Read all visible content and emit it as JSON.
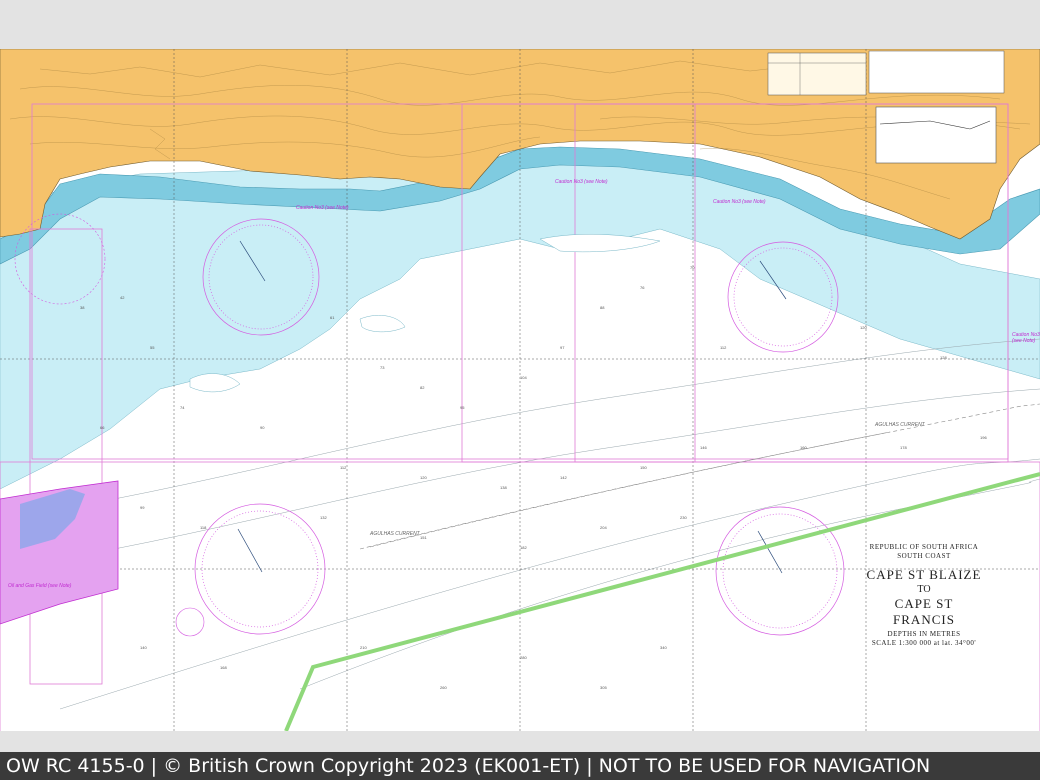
{
  "chart": {
    "republic": "REPUBLIC OF SOUTH AFRICA",
    "coast": "SOUTH COAST",
    "title_line1": "CAPE ST BLAIZE",
    "title_to": "TO",
    "title_line2": "CAPE ST FRANCIS",
    "depths": "DEPTHS IN METRES",
    "scale": "SCALE 1:300 000 at lat. 34°00'",
    "oil_gas_label": "Oil and Gas Field (see Note)",
    "caution_note": "Caution No3 (see Note)",
    "current_label": "AGULHAS CURRENT"
  },
  "footer": {
    "caption": "OW RC 4155-0 | © British Crown Copyright 2023 (EK001-ET) | NOT TO BE USED FOR NAVIGATION"
  },
  "colors": {
    "land": "#f5c26b",
    "shallow": "#79cbe0",
    "mid": "#bfeaf4",
    "deep": "#ffffff",
    "magenta": "#c02bd0",
    "route": "#8fd87a"
  }
}
